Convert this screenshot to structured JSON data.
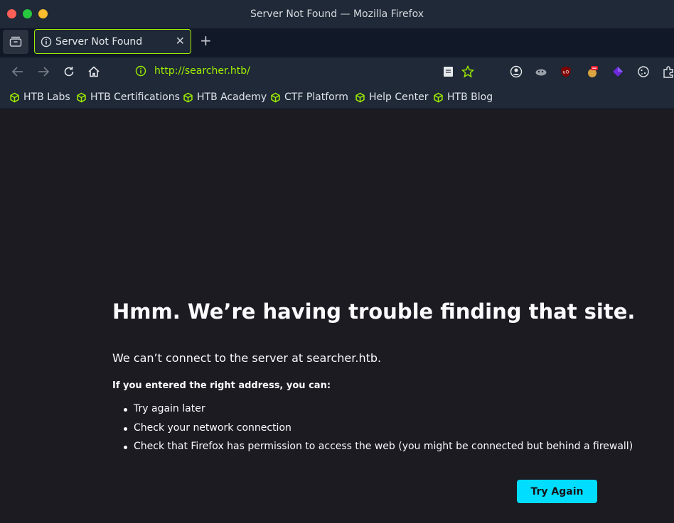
{
  "window": {
    "title": "Server Not Found — Mozilla Firefox"
  },
  "tabs": [
    {
      "title": "Server Not Found",
      "icon": "info-icon",
      "close": "✕"
    }
  ],
  "new_tab_label": "+",
  "navbar": {
    "url": "http://searcher.htb/",
    "icons": [
      "back-icon",
      "forward-icon",
      "reload-icon",
      "home-icon",
      "page-info-icon",
      "reader-icon",
      "bookmark-star-icon",
      "account-icon",
      "extension-icons"
    ]
  },
  "bookmarks": [
    {
      "label": "HTB Labs"
    },
    {
      "label": "HTB Certifications"
    },
    {
      "label": "HTB Academy"
    },
    {
      "label": "CTF Platform"
    },
    {
      "label": "Help Center"
    },
    {
      "label": "HTB Blog"
    }
  ],
  "error_page": {
    "title": "Hmm. We’re having trouble finding that site.",
    "description": "We can’t connect to the server at searcher.htb.",
    "subheading": "If you entered the right address, you can:",
    "suggestions": [
      "Try again later",
      "Check your network connection",
      "Check that Firefox has permission to access the web (you might be connected but behind a firewall)"
    ],
    "try_again_label": "Try Again"
  },
  "colors": {
    "accent_green": "#9fef00",
    "button_cyan": "#00ddff",
    "page_bg": "#1c1b22",
    "chrome_bg": "#1f2937"
  }
}
